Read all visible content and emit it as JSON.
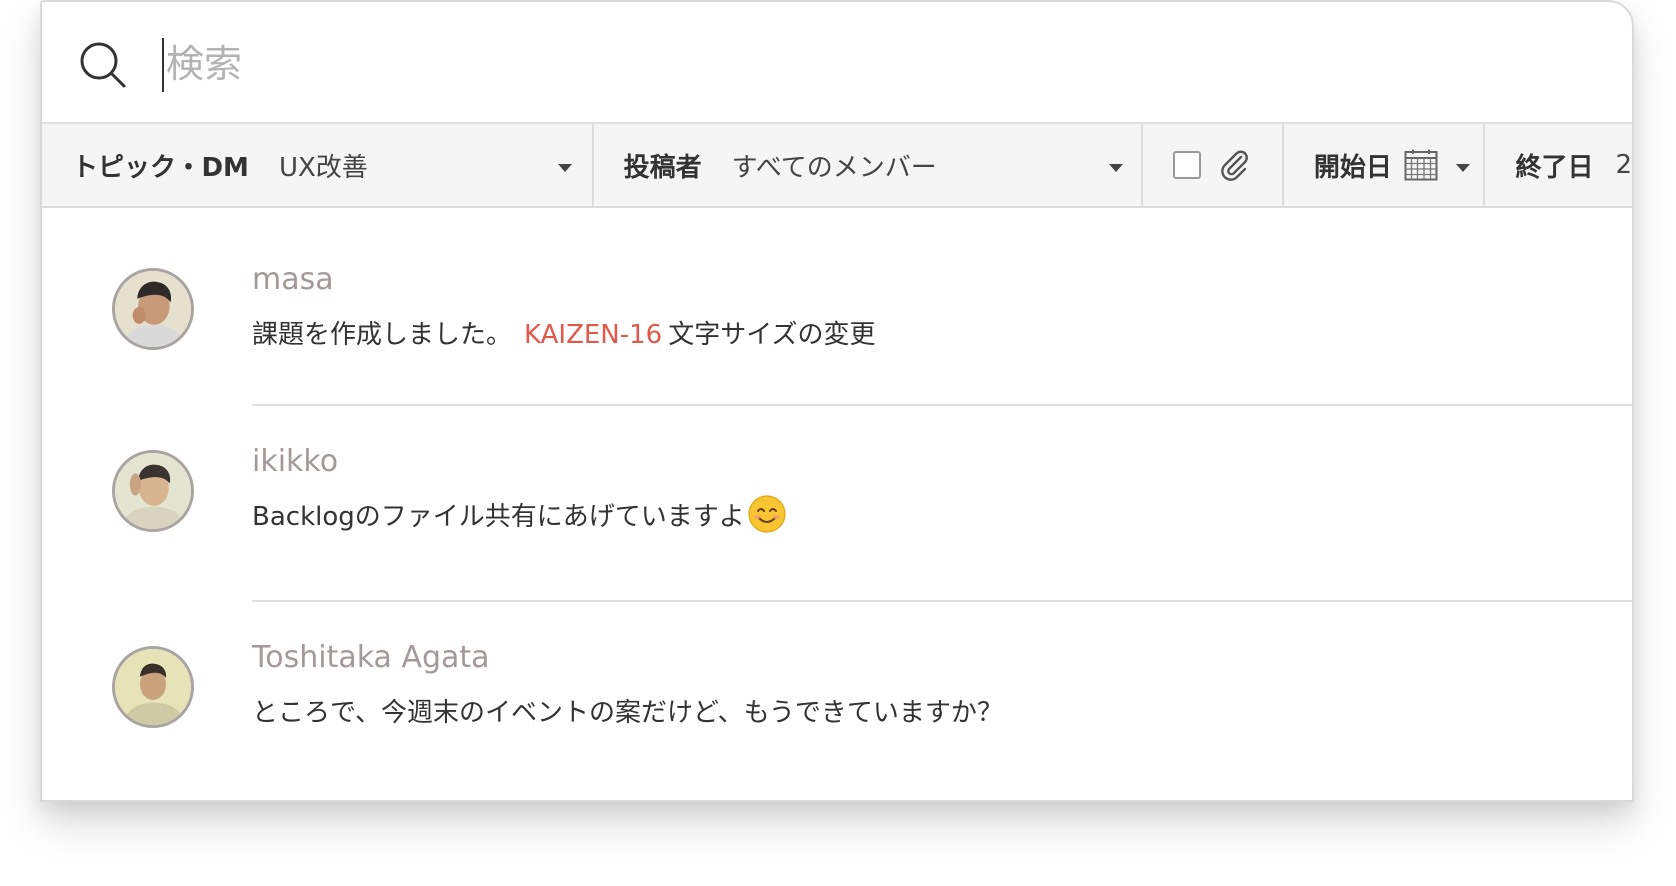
{
  "search": {
    "placeholder": "検索",
    "value": ""
  },
  "filters": {
    "topic": {
      "label": "トピック・DM",
      "value": "UX改善"
    },
    "author": {
      "label": "投稿者",
      "value": "すべてのメンバー"
    },
    "attachment_only_checked": false,
    "start_date": {
      "label": "開始日"
    },
    "end_date": {
      "label": "終了日",
      "value": "2"
    }
  },
  "messages": [
    {
      "author": "masa",
      "text_before": "課題を作成しました。",
      "issue_key": "KAIZEN-16",
      "text_after": "文字サイズの変更"
    },
    {
      "author": "ikikko",
      "text": "Backlogのファイル共有にあげていますよ",
      "emoji": "smiling-face-emoji"
    },
    {
      "author": "Toshitaka Agata",
      "text": "ところで、今週末のイベントの案だけど、もうできていますか？"
    }
  ],
  "colors": {
    "issue_link": "#e2584a",
    "author_name": "#a39a98",
    "filter_bar_bg": "#f5f5f5"
  }
}
